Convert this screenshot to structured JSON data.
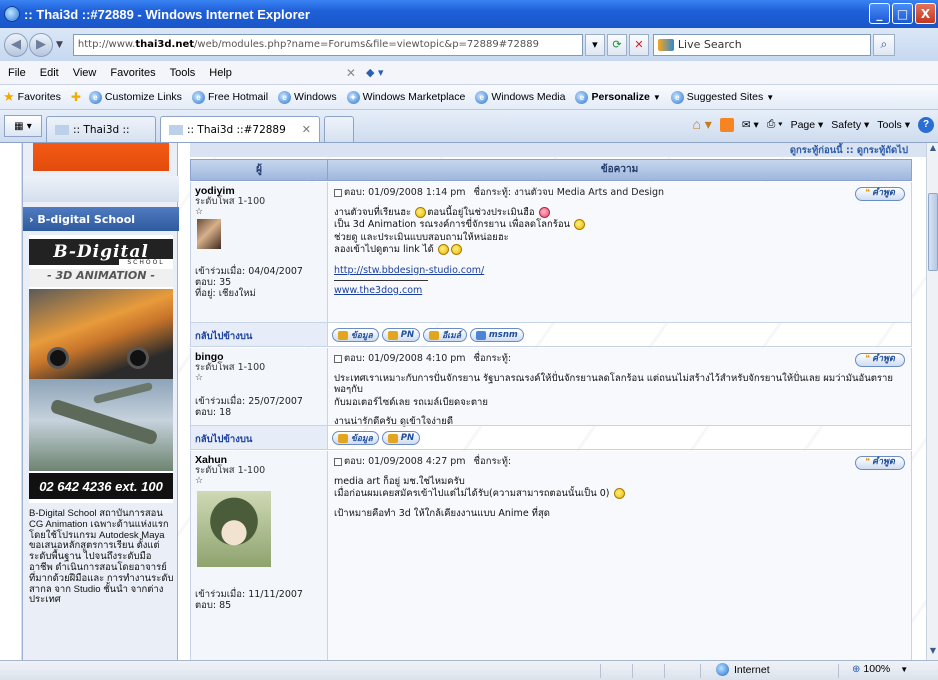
{
  "window": {
    "title": ":: Thai3d ::#72889 - Windows Internet Explorer",
    "buttons": [
      "_",
      "□",
      "X"
    ]
  },
  "address": {
    "url_prefix": "http://www.",
    "url_host": "thai3d.net",
    "url_rest": "/web/modules.php?name=Forums&file=viewtopic&p=72889#72889",
    "search_placeholder": "Live Search"
  },
  "menu": {
    "items": [
      "File",
      "Edit",
      "View",
      "Favorites",
      "Tools",
      "Help"
    ]
  },
  "favorites": {
    "label": "Favorites",
    "links": [
      {
        "label": "Customize Links",
        "bold": false,
        "dropdown": false
      },
      {
        "label": "Free Hotmail",
        "bold": false,
        "dropdown": false
      },
      {
        "label": "Windows",
        "bold": false,
        "dropdown": false
      },
      {
        "label": "Windows Marketplace",
        "bold": false,
        "dropdown": false
      },
      {
        "label": "Windows Media",
        "bold": false,
        "dropdown": false
      },
      {
        "label": "Personalize",
        "bold": true,
        "dropdown": true
      },
      {
        "label": "Suggested Sites",
        "bold": false,
        "dropdown": true
      }
    ]
  },
  "tabs": {
    "items": [
      {
        "label": ":: Thai3d ::",
        "active": false
      },
      {
        "label": ":: Thai3d ::#72889",
        "active": true
      }
    ],
    "commands": [
      "Page",
      "Safety",
      "Tools"
    ]
  },
  "sidebar": {
    "section_title": "B-digital School",
    "promo_logo": "B-Digital",
    "promo_school": "SCHOOL",
    "promo_3d": "- 3D ANIMATION -",
    "phone": "02 642 4236 ext. 100",
    "description": "B-Digital School สถาบันการสอน CG Animation เฉพาะด้านแห่งแรก โดยใช้โปรแกรม Autodesk Maya ขอเสนอหลักสูตรการเรียน ตั้งแต่ระดับพื้นฐาน ไปจนถึงระดับมืออาชีพ ดำเนินการสอนโดยอาจารย์ ที่มากด้วยฝีมือและ การทำงานระดับสากล จาก Studio ชั้นนำ จากต่าง ประเทศ"
  },
  "forum": {
    "top_links": "ดูกระทู้ก่อนนี้ :: ดูกระทู้ถัดไป",
    "col_author": "ผู้",
    "col_message": "ข้อความ",
    "back_to_top": "กลับไปข้างบน",
    "quote_label": "คำพูด",
    "posts": [
      {
        "author": "yodiyim",
        "rank": "ระดับโพส 1-100",
        "stars": "☆",
        "joined": "เข้าร่วมเมื่อ: 04/04/2007",
        "post_count": "ตอบ: 35",
        "location": "ที่อยู่: เชียงใหม่",
        "posted": "ตอบ: 01/09/2008 1:14 pm",
        "subject": "ชื่อกระทู้: งานตัวจบ Media Arts and Design",
        "lines": [
          "งานตัวจบที่เรียนฮะ",
          "ตอนนี้อยู่ในช่วงประเมินฮือ",
          "เป็น 3d Animation รณรงค์การขี่จักรยาน เพื่อลดโลกร้อน",
          "ช่วยดู และประเมินแบบสอบถามให้หน่อยฮะ",
          "ลองเข้าไปดูตาม link ได้"
        ],
        "link1": "http://stw.bbdesign-studio.com/",
        "link2": "www.the3dog.com",
        "buttons": [
          "ข้อมูล",
          "PN",
          "อีเมล์",
          "msnm"
        ]
      },
      {
        "author": "bingo",
        "rank": "ระดับโพส 1-100",
        "stars": "☆",
        "joined": "เข้าร่วมเมื่อ: 25/07/2007",
        "post_count": "ตอบ: 18",
        "posted": "ตอบ: 01/09/2008 4:10 pm",
        "subject": "ชื่อกระทู้:",
        "lines": [
          "ประเทศเราเหมาะกับการปั่นจักรยาน รัฐบาลรณรงค์ให้ปั่นจักรยานลดโลกร้อน แต่ถนนไม่สร้างไว้สำหรับจักรยานให้ปั่นเลย ผมว่ามันอันตรายพอๆกับ",
          "กับมอเตอร์ไซด์เลย รถเมล์เบียดจะตาย",
          "งานน่ารักดีครับ ดูเข้าใจง่ายดี"
        ],
        "buttons": [
          "ข้อมูล",
          "PN"
        ]
      },
      {
        "author": "Xahun",
        "rank": "ระดับโพส 1-100",
        "stars": "☆",
        "joined": "เข้าร่วมเมื่อ: 11/11/2007",
        "post_count": "ตอบ: 85",
        "posted": "ตอบ: 01/09/2008 4:27 pm",
        "subject": "ชื่อกระทู้:",
        "lines": [
          "media art ก็อยู่ มช.ใช่ไหมครับ",
          "เมื่อก่อนผมเคยสมัครเข้าไปแต่ไม่ได้รับ(ความสามารถตอนนั้นเป็น 0)",
          "เป้าหมายคือทำ 3d ให้ใกล้เคียงงานแบบ Anime ที่สุด"
        ]
      }
    ]
  },
  "status": {
    "zone": "Internet",
    "zoom": "100%"
  }
}
